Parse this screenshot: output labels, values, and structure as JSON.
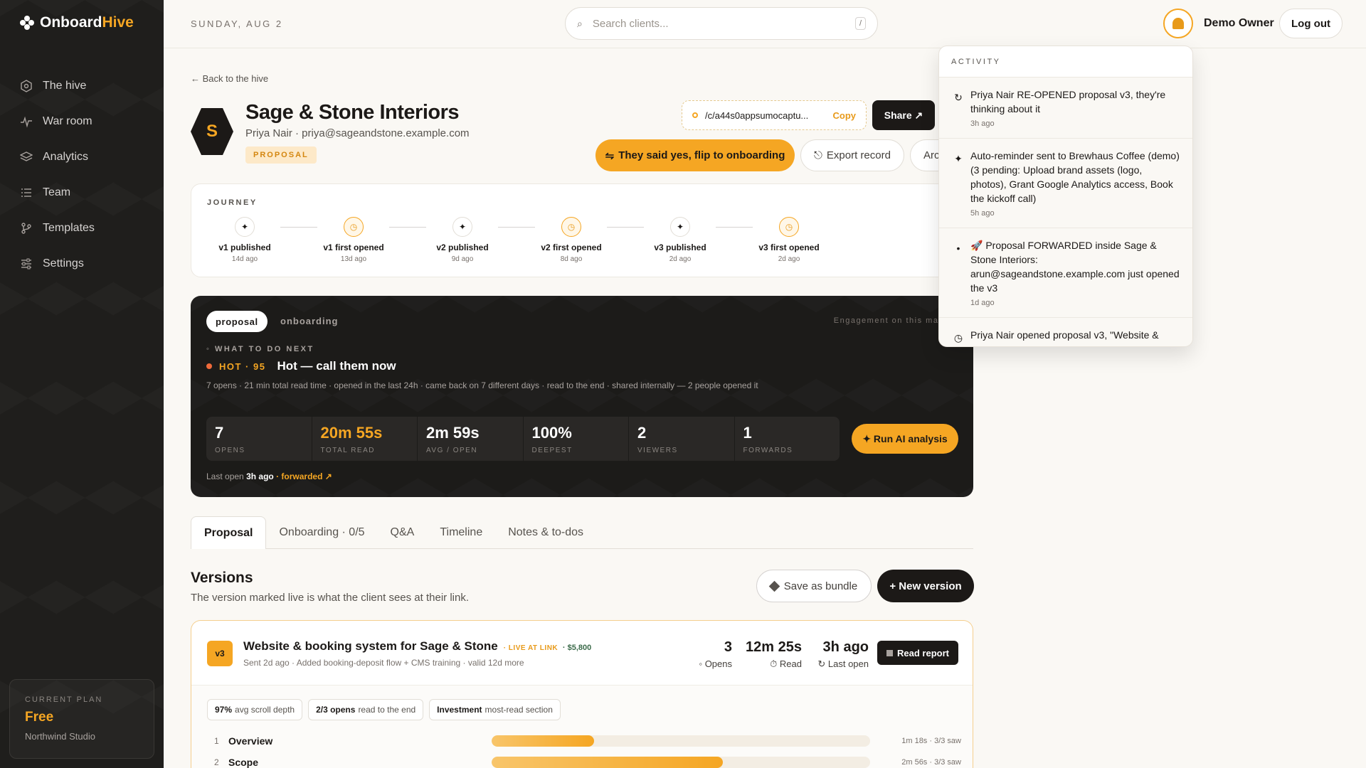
{
  "brand": {
    "name_a": "Onboard",
    "name_b": "Hive"
  },
  "sidebar": {
    "items": [
      {
        "label": "The hive",
        "icon": "hexagon-icon"
      },
      {
        "label": "War room",
        "icon": "pulse-icon"
      },
      {
        "label": "Analytics",
        "icon": "layers-icon"
      },
      {
        "label": "Team",
        "icon": "list-icon"
      },
      {
        "label": "Templates",
        "icon": "branch-icon"
      },
      {
        "label": "Settings",
        "icon": "sliders-icon"
      }
    ],
    "plan": {
      "label": "CURRENT PLAN",
      "value": "Free",
      "org": "Northwind Studio"
    }
  },
  "topbar": {
    "date": "SUNDAY, AUG 2",
    "search_placeholder": "Search clients...",
    "search_shortcut": "/",
    "user": "Demo Owner",
    "logout": "Log out"
  },
  "client": {
    "back": "← Back to the hive",
    "initial": "S",
    "name": "Sage & Stone Interiors",
    "contact": "Priya Nair · priya@sageandstone.example.com",
    "status": "PROPOSAL",
    "link": "/c/a44s0appsumocaptu...",
    "copy": "Copy",
    "share": "Share ↗",
    "flip_button": "They said yes, flip to onboarding",
    "export_button": "Export record",
    "archive_button": "Arc"
  },
  "journey": {
    "title": "JOURNEY",
    "steps": [
      {
        "label": "v1 published",
        "ago": "14d ago",
        "kind": "pub"
      },
      {
        "label": "v1 first opened",
        "ago": "13d ago",
        "kind": "open"
      },
      {
        "label": "v2 published",
        "ago": "9d ago",
        "kind": "pub"
      },
      {
        "label": "v2 first opened",
        "ago": "8d ago",
        "kind": "open"
      },
      {
        "label": "v3 published",
        "ago": "2d ago",
        "kind": "pub"
      },
      {
        "label": "v3 first opened",
        "ago": "2d ago",
        "kind": "open"
      }
    ]
  },
  "engagement": {
    "toggle_on": "proposal",
    "toggle_off": "onboarding",
    "note": "Engagement on this magic",
    "next_label": "◦ WHAT TO DO NEXT",
    "heat": "HOT · 95",
    "heat_msg": "Hot — call them now",
    "signals": "7 opens · 21 min total read time · opened in the last 24h · came back on 7 different days · read to the end · shared internally — 2 people opened it",
    "stats": [
      {
        "value": "7",
        "label": "OPENS",
        "accent": false
      },
      {
        "value": "20m 55s",
        "label": "TOTAL READ",
        "accent": true
      },
      {
        "value": "2m 59s",
        "label": "AVG / OPEN",
        "accent": false
      },
      {
        "value": "100%",
        "label": "DEEPEST",
        "accent": false
      },
      {
        "value": "2",
        "label": "VIEWERS",
        "accent": false
      },
      {
        "value": "1",
        "label": "FORWARDS",
        "accent": false
      }
    ],
    "ai_button": "✦ Run AI analysis",
    "last_open_prefix": "Last open",
    "last_open_value": "3h ago",
    "forwarded": "· forwarded ↗"
  },
  "tabs": [
    {
      "label": "Proposal",
      "active": true
    },
    {
      "label": "Onboarding · 0/5",
      "active": false
    },
    {
      "label": "Q&A",
      "active": false
    },
    {
      "label": "Timeline",
      "active": false
    },
    {
      "label": "Notes & to-dos",
      "active": false
    }
  ],
  "versions": {
    "title": "Versions",
    "subtitle": "The version marked live is what the client sees at their link.",
    "save_bundle": "Save as bundle",
    "new_version": "+ New version",
    "card": {
      "badge": "v3",
      "title": "Website & booking system for Sage & Stone",
      "live": "· LIVE AT LINK",
      "price": "· $5,800",
      "meta": "Sent 2d ago · Added booking-deposit flow + CMS training · valid 12d more",
      "opens": "3",
      "opens_label": "◦ Opens",
      "read": "12m 25s",
      "read_label": "⏱ Read",
      "last": "3h ago",
      "last_label": "↻ Last open",
      "report": "Read report",
      "chips": [
        {
          "bold": "97%",
          "rest": "avg scroll depth"
        },
        {
          "bold": "2/3 opens",
          "rest": "read to the end"
        },
        {
          "bold": "Investment",
          "rest": "most-read section"
        }
      ],
      "sections": [
        {
          "num": "1",
          "name": "Overview",
          "fill": 0.27,
          "meta": "1m 18s · 3/3 saw"
        },
        {
          "num": "2",
          "name": "Scope",
          "fill": 0.61,
          "meta": "2m 56s · 3/3 saw"
        }
      ]
    }
  },
  "activity": {
    "title": "ACTIVITY",
    "items": [
      {
        "icon": "↻",
        "icon_name": "reopen-icon",
        "text": "Priya Nair RE-OPENED proposal v3, they're thinking about it",
        "ago": "3h ago"
      },
      {
        "icon": "✦",
        "icon_name": "sparkle-icon",
        "text": "Auto-reminder sent to Brewhaus Coffee (demo) (3 pending: Upload brand assets (logo, photos), Grant Google Analytics access, Book the kickoff call)",
        "ago": "5h ago"
      },
      {
        "icon": "•",
        "icon_name": "dot-icon",
        "text": "🚀 Proposal FORWARDED inside Sage & Stone Interiors: arun@sageandstone.example.com just opened the v3",
        "ago": "1d ago"
      },
      {
        "icon": "◷",
        "icon_name": "clock-icon",
        "text": "Priya Nair opened proposal v3, \"Website &",
        "ago": ""
      }
    ]
  }
}
